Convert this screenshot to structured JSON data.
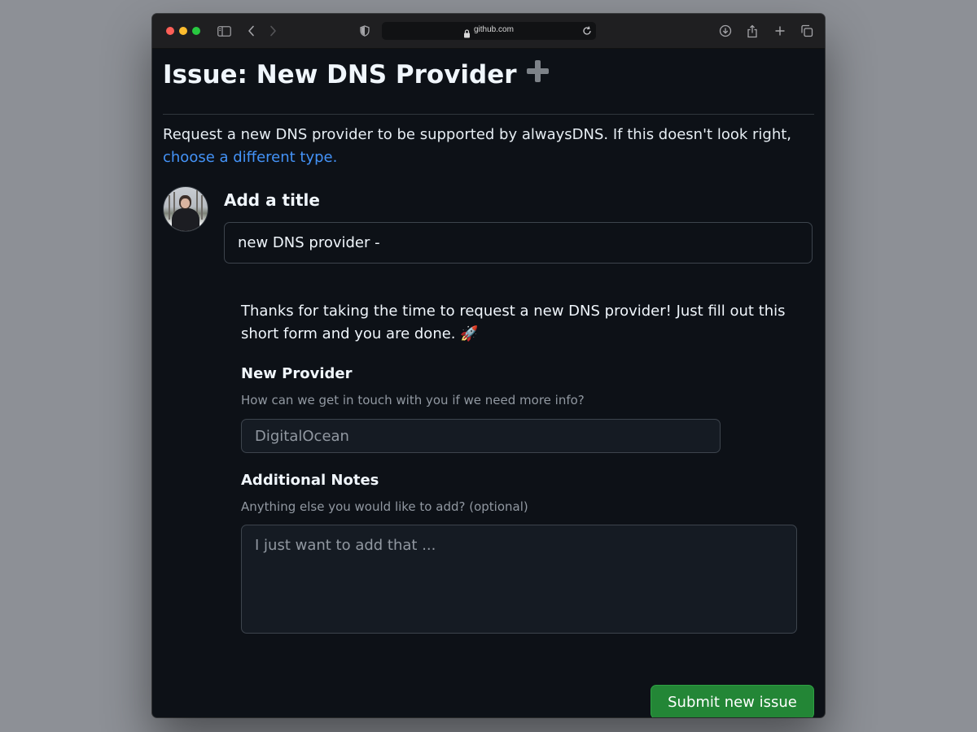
{
  "browser": {
    "url": "github.com",
    "icons": [
      "sidebar-icon",
      "back-icon",
      "forward-icon",
      "shield-icon",
      "lock-icon",
      "reload-icon",
      "download-icon",
      "share-icon",
      "new-tab-icon",
      "tabs-overview-icon"
    ]
  },
  "page": {
    "title": "Issue: New DNS Provider",
    "title_icon": "plus-icon",
    "description": "Request a new DNS provider to be supported by alwaysDNS. If this doesn't look right,",
    "change_type_link": "choose a different type.",
    "add_title_label": "Add a title",
    "title_value": "new DNS provider -",
    "intro_text": "Thanks for taking the time to request a new DNS provider! Just fill out this short form and you are done. 🚀",
    "new_provider": {
      "label": "New Provider",
      "help": "How can we get in touch with you if we need more info?",
      "placeholder": "DigitalOcean"
    },
    "additional_notes": {
      "label": "Additional Notes",
      "help": "Anything else you would like to add? (optional)",
      "placeholder": "I just want to add that ..."
    },
    "submit_label": "Submit new issue"
  },
  "colors": {
    "background": "#0d1117",
    "link": "#4493f8",
    "submit": "#238636"
  }
}
